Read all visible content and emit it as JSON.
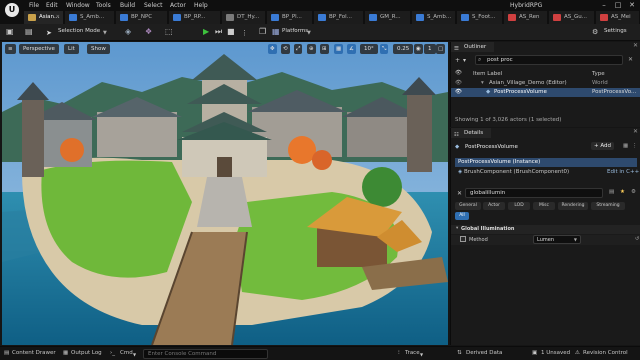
{
  "titlebar": {
    "app_title": "HybridRPG",
    "menu": [
      "File",
      "Edit",
      "Window",
      "Tools",
      "Build",
      "Select",
      "Actor",
      "Help"
    ],
    "tabs": [
      "Asian...",
      "S_Amb...",
      "BP_NPC",
      "BP_RP...",
      "DT_Hy...",
      "BP_Pl...",
      "BP_Fol...",
      "GM_R...",
      "S_Amb...",
      "S_Foot...",
      "AS_Ren",
      "AS_Gu...",
      "AS_Mei"
    ],
    "tab_colors": [
      "#c9a14a",
      "#3a7bd5",
      "#3a7bd5",
      "#3a7bd5",
      "#7a7a7a",
      "#3a7bd5",
      "#3a7bd5",
      "#3a7bd5",
      "#3a7bd5",
      "#3a7bd5",
      "#d04040",
      "#d04040",
      "#d04040"
    ]
  },
  "toolbar": {
    "selection_mode": "Selection Mode",
    "platforms": "Platforms",
    "settings": "Settings"
  },
  "viewport": {
    "perspective": "Perspective",
    "lit": "Lit",
    "show": "Show",
    "snap_angle": "10°",
    "snap_scale": "0.25",
    "camera_speed": "1",
    "layout": "1"
  },
  "outliner": {
    "tab_label": "Outliner",
    "search_value": "post proc",
    "col_item_label": "Item Label",
    "col_type": "Type",
    "rows": [
      {
        "label": "Asian_Village_Demo (Editor)",
        "type": "World"
      },
      {
        "label": "PostProcessVolume",
        "type": "PostProcessVo..."
      }
    ],
    "status": "Showing 1 of 3,026 actors (1 selected)"
  },
  "details": {
    "tab_label": "Details",
    "actor_name": "PostProcessVolume",
    "add_button": "+ Add",
    "components": [
      {
        "label": "PostProcessVolume (Instance)"
      },
      {
        "label": "BrushComponent (BrushComponent0)",
        "action": "Edit in C++"
      }
    ],
    "search_value": "globalillumin",
    "filters": [
      "General",
      "Actor",
      "LOD",
      "Misc",
      "Rendering",
      "Streaming",
      "All"
    ],
    "active_filter": "All",
    "section": "Global Illumination",
    "property_label": "Method",
    "property_value": "Lumen"
  },
  "statusbar": {
    "content_drawer": "Content Drawer",
    "output_log": "Output Log",
    "cmd": "Cmd",
    "console_placeholder": "Enter Console Command",
    "trace": "Trace",
    "derived_data": "Derived Data",
    "unsaved": "1 Unsaved",
    "revision_control": "Revision Control"
  },
  "colors": {
    "accent": "#2f6fb2",
    "selection": "#2e4a6e",
    "play_green": "#3ec23e"
  }
}
